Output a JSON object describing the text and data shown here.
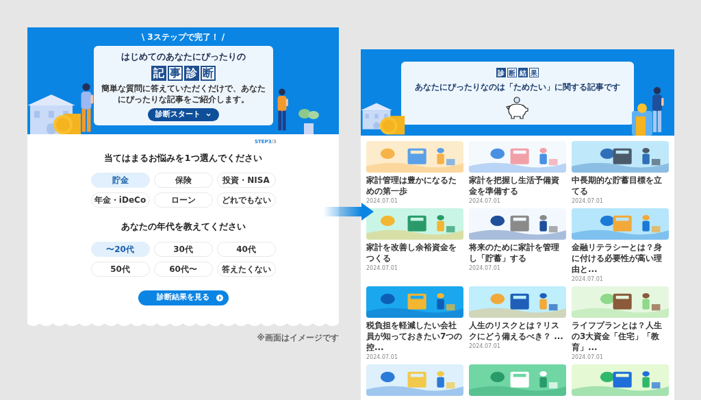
{
  "intro_screen": {
    "badge": "\\ 3ステップで完了！ /",
    "card": {
      "lead": "はじめてのあなたにぴったりの",
      "title_chars": [
        "記",
        "事",
        "診",
        "断"
      ],
      "description": "簡単な質問に答えていただくだけで、あなたにぴったりな記事をご紹介します。",
      "start_button": "診断スタート"
    },
    "step": {
      "current": "STEP3",
      "total": "/3"
    },
    "questions": [
      {
        "title": "当てはまるお悩みを1つ選んでください",
        "options": [
          {
            "label": "貯金",
            "selected": true
          },
          {
            "label": "保険",
            "selected": false
          },
          {
            "label": "投資・NISA",
            "selected": false
          },
          {
            "label": "年金・iDeCo",
            "selected": false
          },
          {
            "label": "ローン",
            "selected": false
          },
          {
            "label": "どれでもない",
            "selected": false
          }
        ]
      },
      {
        "title": "あなたの年代を教えてください",
        "options": [
          {
            "label": "〜20代",
            "selected": true
          },
          {
            "label": "30代",
            "selected": false
          },
          {
            "label": "40代",
            "selected": false
          },
          {
            "label": "50代",
            "selected": false
          },
          {
            "label": "60代〜",
            "selected": false
          },
          {
            "label": "答えたくない",
            "selected": false
          }
        ]
      }
    ],
    "submit_button": "診断結果を見る"
  },
  "note": "※画面はイメージです",
  "result_screen": {
    "badge_chars": [
      "診",
      "断",
      "結",
      "果"
    ],
    "message": "あなたにぴったりなのは「ためたい」に関する記事です",
    "articles": [
      {
        "kind": "picture",
        "title": "家計管理は豊かになるための第一歩",
        "date": "2024.07.01"
      },
      {
        "kind": "picture",
        "title": "家計を把握し生活予備資金を準備する",
        "date": "2024.07.01"
      },
      {
        "kind": "picture",
        "title": "中長期的な貯蓄目標を立てる",
        "date": "2024.07.01"
      },
      {
        "kind": "picture",
        "title": "家計を改善し余裕資金をつくる",
        "date": "2024.07.01"
      },
      {
        "kind": "picture",
        "title": "将来のために家計を管理し「貯蓄」する",
        "date": "2024.07.01"
      },
      {
        "kind": "picture",
        "title": "金融リテラシーとは？身に付ける必要性が高い理由と...",
        "date": "2024.07.01"
      },
      {
        "kind": "picture",
        "title": "税負担を軽減したい会社員が知っておきたい7つの控...",
        "date": "2024.07.01"
      },
      {
        "kind": "picture",
        "title": "人生のリスクとは？リスクにどう備えるべき？ ...",
        "date": "2024.07.01"
      },
      {
        "kind": "picture",
        "title": "ライフプランとは？人生の3大資金「住宅」「教育」...",
        "date": "2024.07.01"
      },
      {
        "kind": "picture"
      },
      {
        "kind": "picture"
      },
      {
        "kind": "picture"
      }
    ]
  }
}
